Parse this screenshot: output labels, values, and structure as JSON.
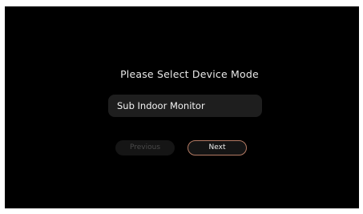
{
  "screen": {
    "title": "Please Select Device Mode",
    "mode_value": "Sub Indoor Monitor",
    "previous_label": "Previous",
    "next_label": "Next",
    "previous_enabled": false
  },
  "colors": {
    "background": "#000000",
    "field_background": "#1e1e1e",
    "next_border": "#b37a63",
    "disabled_text": "#4a4a4a"
  }
}
